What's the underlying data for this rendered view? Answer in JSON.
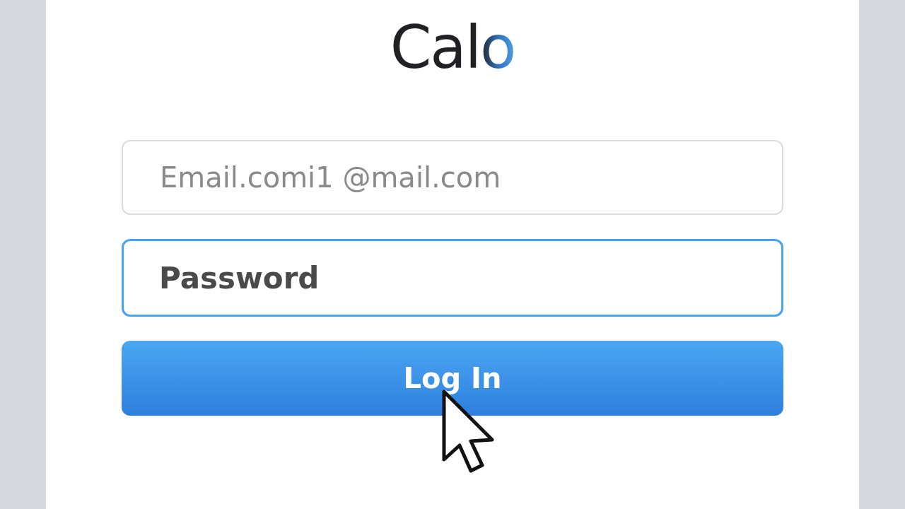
{
  "logo": {
    "text": "Calo"
  },
  "fields": [
    {
      "placeholder": "Email.comi1 @mail.com",
      "focused": false
    },
    {
      "placeholder": "Password",
      "focused": true
    }
  ],
  "button": {
    "label": "Log In"
  },
  "pointer": {
    "shown": true
  }
}
